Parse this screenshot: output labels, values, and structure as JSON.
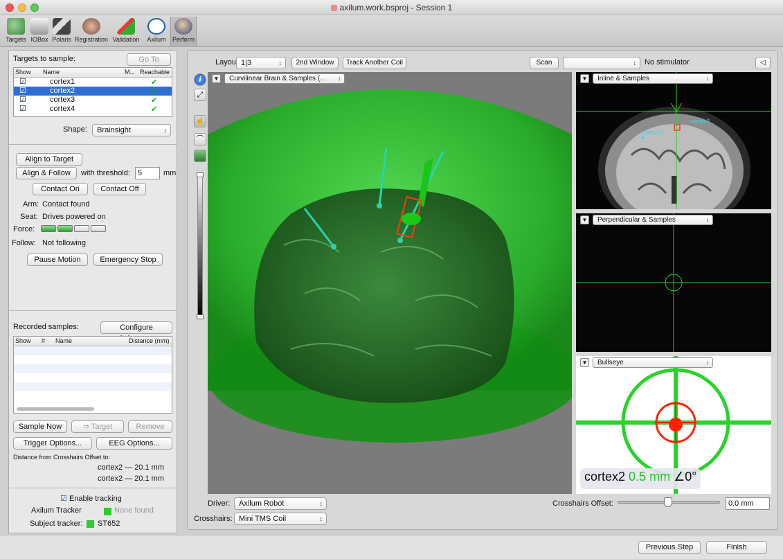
{
  "window": {
    "title": "axilum.work.bsproj - Session 1"
  },
  "toolbar": {
    "items": [
      "Targets",
      "IOBox",
      "Polaris",
      "Registration",
      "Validation",
      "Axilum",
      "Perform"
    ]
  },
  "targets": {
    "title": "Targets to sample:",
    "go_to": "Go To",
    "columns": {
      "show": "Show",
      "name": "Name",
      "m": "M...",
      "reachable": "Reachable"
    },
    "rows": [
      {
        "name": "cortex1",
        "reachable": "✔"
      },
      {
        "name": "cortex2",
        "reachable": "✔"
      },
      {
        "name": "cortex3",
        "reachable": "✔"
      },
      {
        "name": "cortex4",
        "reachable": "✔"
      }
    ],
    "shape_label": "Shape:",
    "shape_value": "Brainsight"
  },
  "robot": {
    "align_to_target": "Align to Target",
    "align_follow": "Align & Follow",
    "threshold_label": "with threshold:",
    "threshold_value": "5",
    "threshold_unit": "mm",
    "contact_on": "Contact On",
    "contact_off": "Contact Off",
    "arm_label": "Arm:",
    "arm_value": "Contact found",
    "seat_label": "Seat:",
    "seat_value": "Drives powered on",
    "force_label": "Force:",
    "force_level": 0.5,
    "follow_label": "Follow:",
    "follow_value": "Not following",
    "pause_motion": "Pause Motion",
    "emergency_stop": "Emergency Stop"
  },
  "samples": {
    "title": "Recorded samples:",
    "configure": "Configure Columns...",
    "columns": {
      "show": "Show",
      "num": "#",
      "name": "Name",
      "distance": "Distance (mm)"
    },
    "sample_now": "Sample Now",
    "to_target": "⇒ Target",
    "remove": "Remove",
    "trigger_options": "Trigger Options...",
    "eeg_options": "EEG Options...",
    "distance_title": "Distance from Crosshairs Offset to:",
    "distance_1": "cortex2 — 20.1 mm",
    "distance_2": "cortex2 — 20.1 mm"
  },
  "tracking": {
    "enable": "Enable tracking",
    "axilum_label": "Axilum Tracker",
    "axilum_value": "None found",
    "subject_label": "Subject tracker:",
    "subject_value": "ST652"
  },
  "main": {
    "layout_label": "Layout:",
    "layout_value": "1|3",
    "second_window": "2nd Window",
    "track_another": "Track Another Coil",
    "scan": "Scan",
    "scan_select": "",
    "stimulator": "No stimulator",
    "view3d_select": "Curvilinear Brain & Samples (...",
    "inline_select": "Inline & Samples",
    "perp_select": "Perpendicular & Samples",
    "bullseye_select": "Bullseye",
    "mri_labels": {
      "cortex2": "cortex2",
      "cortex4": "cortex4"
    },
    "bullseye_target": "cortex2",
    "bullseye_distance": "0.5 mm",
    "bullseye_angle": "∠0°",
    "driver_label": "Driver:",
    "driver_value": "Axilum Robot",
    "crosshairs_label": "Crosshairs:",
    "crosshairs_value": "Mini TMS Coil",
    "offset_label": "Crosshairs Offset:",
    "offset_value": "0.0 mm"
  },
  "footer": {
    "previous": "Previous Step",
    "finish": "Finish"
  },
  "colors": {
    "selection": "#2f6fd2",
    "green": "#2ecc2e",
    "accent_red": "#ff2200"
  }
}
